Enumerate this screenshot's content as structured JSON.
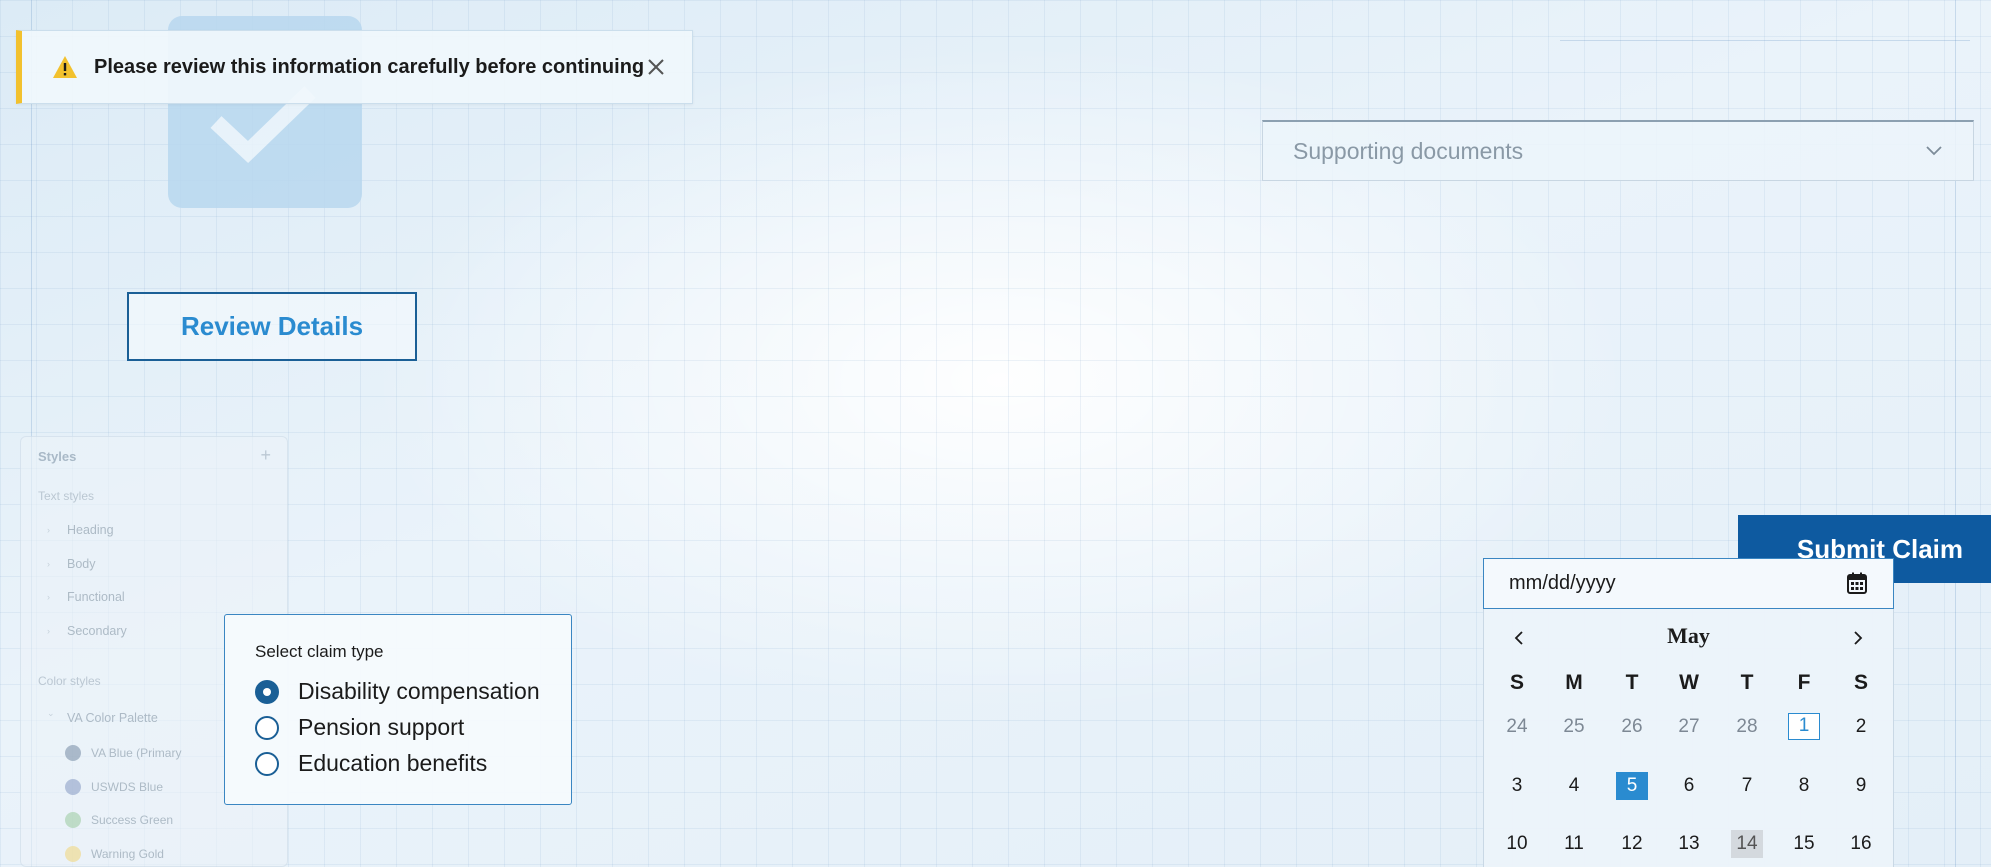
{
  "alert": {
    "message": "Please review this information carefully before continuing",
    "icon": "warning-icon",
    "accent": "#f2c12e"
  },
  "check_tile": {
    "icon": "checkmark-icon",
    "color": "#b9d8ef"
  },
  "review_button": {
    "label": "Review Details"
  },
  "styles_panel": {
    "title": "Styles",
    "text_styles_heading": "Text styles",
    "text_styles": [
      "Heading",
      "Body",
      "Functional",
      "Secondary"
    ],
    "color_styles_heading": "Color styles",
    "palette_name": "VA Color Palette",
    "colors": [
      {
        "name": "VA Blue (Primary",
        "color": "#9fb0c2"
      },
      {
        "name": "USWDS Blue",
        "color": "#aab9d6"
      },
      {
        "name": "Success Green",
        "color": "#b7d8bf"
      },
      {
        "name": "Warning Gold",
        "color": "#f0e0a6"
      }
    ]
  },
  "claim_type": {
    "legend": "Select claim type",
    "options": [
      {
        "label": "Disability compensation",
        "selected": true
      },
      {
        "label": "Pension support",
        "selected": false
      },
      {
        "label": "Education benefits",
        "selected": false
      }
    ]
  },
  "supporting_docs": {
    "label": "Supporting documents",
    "icon": "chevron-down-icon"
  },
  "submit": {
    "label": "Submit Claim",
    "color": "#0e5aa0"
  },
  "date_picker": {
    "placeholder": "mm/dd/yyyy",
    "month": "May",
    "weekdays": [
      "S",
      "M",
      "T",
      "W",
      "T",
      "F",
      "S"
    ],
    "weeks": [
      [
        {
          "d": "24",
          "muted": true
        },
        {
          "d": "25",
          "muted": true
        },
        {
          "d": "26",
          "muted": true
        },
        {
          "d": "27",
          "muted": true
        },
        {
          "d": "28",
          "muted": true
        },
        {
          "d": "1",
          "today": true
        },
        {
          "d": "2"
        }
      ],
      [
        {
          "d": "3"
        },
        {
          "d": "4"
        },
        {
          "d": "5",
          "selected": true
        },
        {
          "d": "6"
        },
        {
          "d": "7"
        },
        {
          "d": "8"
        },
        {
          "d": "9"
        }
      ],
      [
        {
          "d": "10"
        },
        {
          "d": "11"
        },
        {
          "d": "12"
        },
        {
          "d": "13"
        },
        {
          "d": "14",
          "hover": true
        },
        {
          "d": "15"
        },
        {
          "d": "16"
        }
      ]
    ]
  }
}
